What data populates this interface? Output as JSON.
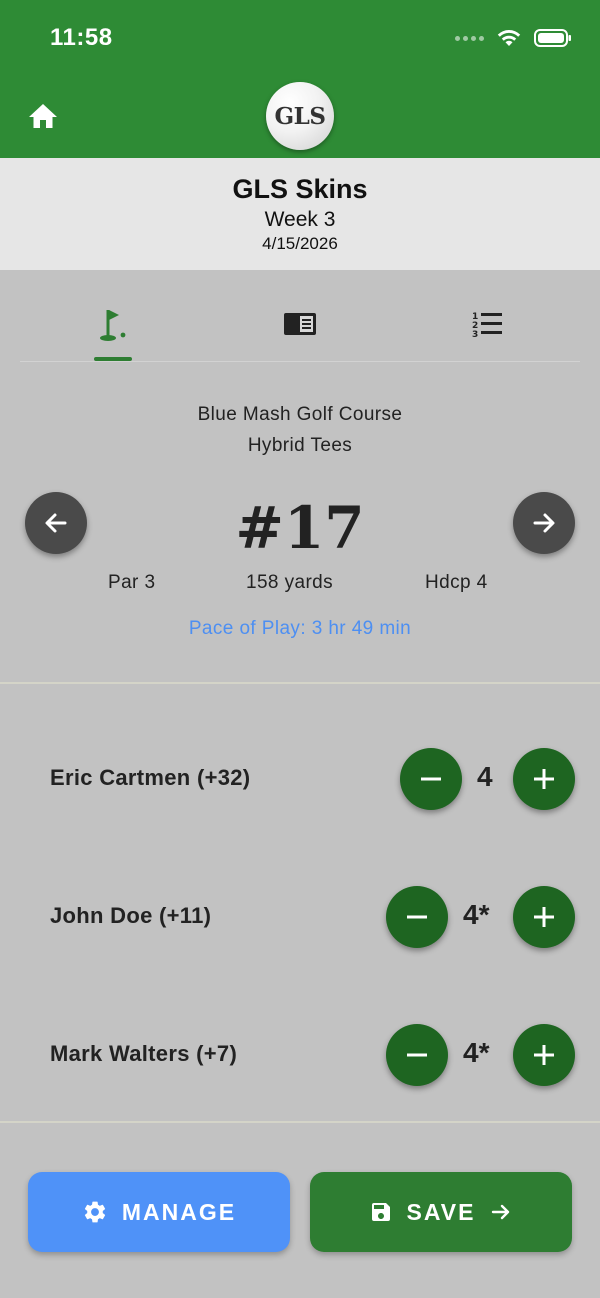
{
  "status_bar": {
    "time": "11:58"
  },
  "header": {
    "logo_text": "GLS",
    "icons": [
      "home-icon"
    ]
  },
  "event": {
    "title": "GLS Skins",
    "week": "Week 3",
    "date": "4/15/2026"
  },
  "tabs": [
    {
      "icon": "golf-flag-icon",
      "active": true
    },
    {
      "icon": "scorecard-icon",
      "active": false
    },
    {
      "icon": "numbered-list-icon",
      "active": false
    }
  ],
  "hole": {
    "course": "Blue Mash Golf Course",
    "tees": "Hybrid Tees",
    "number": "#17",
    "par": "Par 3",
    "yards": "158 yards",
    "hdcp": "Hdcp 4",
    "pace": "Pace of Play: 3 hr 49 min",
    "nav_icons": [
      "arrow-left-icon",
      "arrow-right-icon"
    ]
  },
  "players": [
    {
      "name": "Eric Cartmen (+32)",
      "score": "4"
    },
    {
      "name": "John Doe (+11)",
      "score": "4*"
    },
    {
      "name": "Mark Walters (+7)",
      "score": "4*"
    }
  ],
  "actions": {
    "manage_label": "MANAGE",
    "save_label": "SAVE"
  },
  "colors": {
    "header_green": "#2e8b35",
    "button_green": "#1e6521",
    "save_green": "#2e7d32",
    "manage_blue": "#4f92f8",
    "pace_blue": "#4d8ff2",
    "background": "#c2c2c2"
  }
}
